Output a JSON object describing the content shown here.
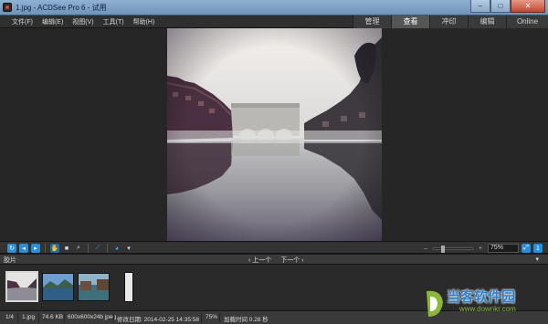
{
  "window": {
    "title": "1.jpg - ACDSee Pro 6 - 试用",
    "controls": {
      "minimize": "–",
      "maximize": "□",
      "close": "✕"
    }
  },
  "menu": {
    "items": [
      {
        "label": "文件(F)"
      },
      {
        "label": "编辑(E)"
      },
      {
        "label": "视图(V)"
      },
      {
        "label": "工具(T)"
      },
      {
        "label": "帮助(H)"
      }
    ]
  },
  "modes": [
    {
      "label": "管理",
      "active": false
    },
    {
      "label": "查看",
      "active": true
    },
    {
      "label": "冲印",
      "active": false
    },
    {
      "label": "编辑",
      "active": false
    },
    {
      "label": "Online",
      "active": false
    }
  ],
  "toolbar": {
    "zoom_value": "75%",
    "accent": "#2a8fd8"
  },
  "filmstrip": {
    "label": "胶片",
    "prev_label": "上一个",
    "next_label": "下一个",
    "collapse_glyph": "▾"
  },
  "status": {
    "position": "1/4",
    "filename": "1.jpg",
    "filesize": "74.6 KB",
    "dimensions": "600x600x24b jpeg",
    "modified": "修改日期: 2014-02-25 14:35:58",
    "zoom": "75%",
    "load_time": "加载时间 0.28 秒"
  },
  "watermark": {
    "text": "当客软件园",
    "url": "www.downkr.com"
  }
}
